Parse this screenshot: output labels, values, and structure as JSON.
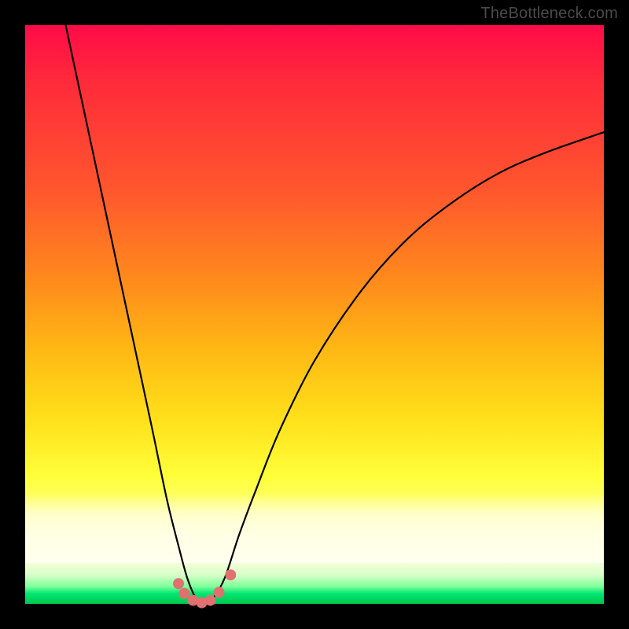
{
  "watermark": "TheBottleneck.com",
  "chart_data": {
    "type": "line",
    "title": "",
    "xlabel": "",
    "ylabel": "",
    "xlim": [
      0,
      1
    ],
    "ylim": [
      0,
      1
    ],
    "series": [
      {
        "name": "bottleneck-curve",
        "x": [
          0.07,
          0.1,
          0.13,
          0.16,
          0.19,
          0.22,
          0.245,
          0.265,
          0.28,
          0.295,
          0.31,
          0.325,
          0.345,
          0.37,
          0.4,
          0.44,
          0.5,
          0.58,
          0.66,
          0.74,
          0.82,
          0.9,
          1.0
        ],
        "y": [
          1.0,
          0.86,
          0.72,
          0.58,
          0.44,
          0.3,
          0.18,
          0.1,
          0.045,
          0.01,
          0.0,
          0.01,
          0.045,
          0.12,
          0.2,
          0.3,
          0.42,
          0.54,
          0.63,
          0.695,
          0.745,
          0.78,
          0.815
        ]
      }
    ],
    "markers": {
      "name": "near-minimum-points",
      "color": "#e17070",
      "points_xy": [
        [
          0.265,
          0.035
        ],
        [
          0.275,
          0.018
        ],
        [
          0.29,
          0.006
        ],
        [
          0.305,
          0.002
        ],
        [
          0.32,
          0.006
        ],
        [
          0.335,
          0.02
        ],
        [
          0.355,
          0.05
        ]
      ]
    },
    "minimum_x": 0.31
  }
}
